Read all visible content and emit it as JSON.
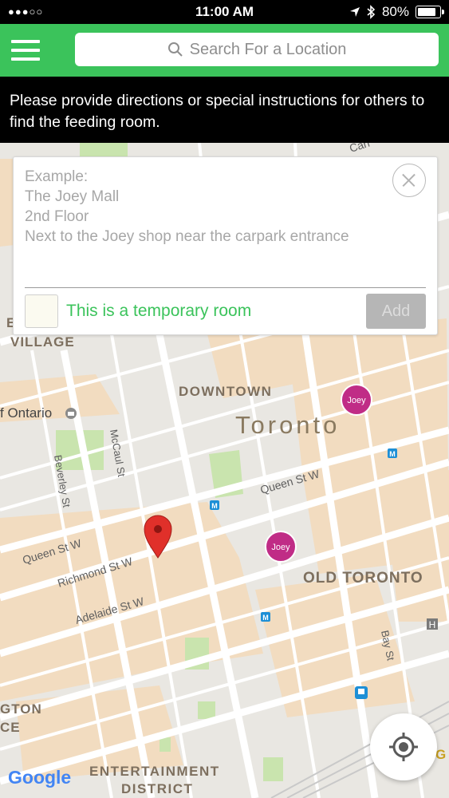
{
  "status_bar": {
    "signal": "●●●○○",
    "time": "11:00 AM",
    "battery": "80%",
    "icons": [
      "location-arrow-icon",
      "bluetooth-icon",
      "battery-icon"
    ]
  },
  "header": {
    "search_placeholder": "Search For a Location",
    "menu_icon": "hamburger-icon",
    "accent_color": "#3bc35b"
  },
  "instructions": "Please provide directions or special instructions for others to find the feeding room.",
  "form": {
    "example_text": "Example:\nThe Joey Mall\n2nd Floor\nNext to the Joey shop near the carpark entrance",
    "temporary_label": "This is a temporary room",
    "add_label": "Add"
  },
  "map": {
    "labels": {
      "downtown": "DOWNTOWN",
      "toronto": "Toronto",
      "old_toronto": "OLD TORONTO",
      "village": "VILLAGE",
      "village_prefix": "E",
      "entertainment": "ENTERTAINMENT",
      "district": "DISTRICT",
      "gton": "GTON",
      "ce": "CE",
      "of_ontario": "f Ontario",
      "queen_st_w_right": "Queen St W",
      "queen_st_w_left": "Queen St W",
      "richmond_st_w": "Richmond St W",
      "adelaide_st_w": "Adelaide St W",
      "mccaul_st": "McCaul St",
      "beverley_st": "Beverley St",
      "bay_st": "Bay St",
      "canal_partial": "Can",
      "g_edge": "G"
    },
    "markers": [
      "Joey",
      "Joey"
    ],
    "metro_symbol": "M",
    "attribution": "Google"
  }
}
